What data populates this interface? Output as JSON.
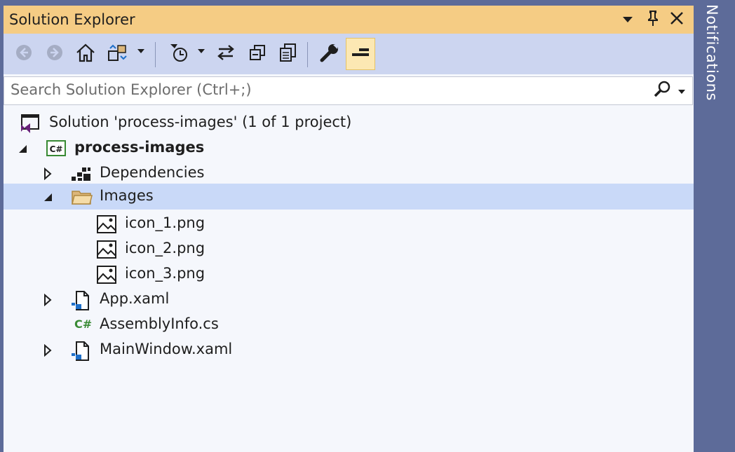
{
  "window": {
    "title": "Solution Explorer"
  },
  "titlebar": {
    "icons": [
      "chevron-down-icon",
      "pin-icon",
      "close-icon"
    ]
  },
  "toolbar": {
    "buttons": [
      "back-icon",
      "forward-icon",
      "home-icon",
      "switch-views-icon",
      "pending-changes-filter-icon",
      "sync-with-active-document-icon",
      "collapse-all-icon",
      "show-all-files-icon",
      "properties-icon",
      "preview-selected-items-icon"
    ]
  },
  "search": {
    "placeholder": "Search Solution Explorer (Ctrl+;)",
    "value": ""
  },
  "tree": {
    "solution": "Solution 'process-images' (1 of 1 project)",
    "project": "process-images",
    "dependencies": "Dependencies",
    "images_folder": "Images",
    "image1": "icon_1.png",
    "image2": "icon_2.png",
    "image3": "icon_3.png",
    "app_xaml": "App.xaml",
    "assemblyinfo": "AssemblyInfo.cs",
    "mainwindow": "MainWindow.xaml"
  },
  "side_tab": {
    "label": "Notifications"
  },
  "colors": {
    "titlebar": "#f5cc84",
    "toolbar": "#ccd5f0",
    "selection": "#c9d9f8",
    "sidebar": "#5d6b99",
    "csharp_green": "#388a34",
    "vs_purple": "#68217a",
    "folder": "#dcb67a"
  }
}
